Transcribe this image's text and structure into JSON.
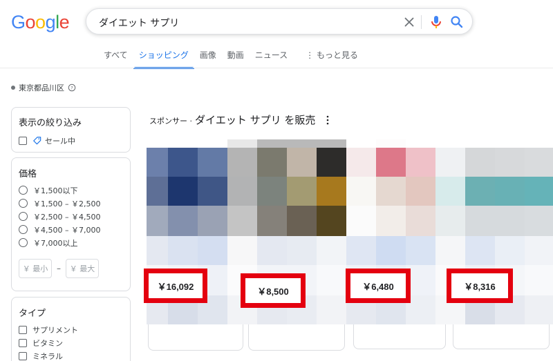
{
  "logo": {
    "letters": [
      "G",
      "o",
      "o",
      "g",
      "l",
      "e"
    ],
    "colors": [
      "#4285f4",
      "#ea4335",
      "#fbbc05",
      "#4285f4",
      "#34a853",
      "#ea4335"
    ]
  },
  "search": {
    "query": "ダイエット サプリ"
  },
  "icons": {
    "clear": "close-icon",
    "mic": "microphone-icon",
    "search": "search-icon",
    "help": "help-circle-icon",
    "kebab": "more-vert-icon",
    "tag": "sale-tag-icon"
  },
  "tabs": [
    {
      "label": "すべて",
      "active": false
    },
    {
      "label": "ショッピング",
      "active": true
    },
    {
      "label": "画像",
      "active": false
    },
    {
      "label": "動画",
      "active": false
    },
    {
      "label": "ニュース",
      "active": false
    },
    {
      "label": "⋮ もっと見る",
      "active": false
    }
  ],
  "location": {
    "label": "東京都品川区"
  },
  "filters": {
    "refine": {
      "title": "表示の絞り込み",
      "sale_label": "セール中"
    },
    "price": {
      "title": "価格",
      "options": [
        "￥1,500以下",
        "￥1,500 – ￥2,500",
        "￥2,500 – ￥4,500",
        "￥4,500 – ￥7,000",
        "￥7,000以上"
      ],
      "min_placeholder": "￥ 最小",
      "dash": "–",
      "max_placeholder": "￥ 最大"
    },
    "type": {
      "title": "タイプ",
      "options": [
        "サプリメント",
        "ビタミン",
        "ミネラル"
      ]
    }
  },
  "sponsored": {
    "prefix": "スポンサー ·",
    "heading": "ダイエット サプリ を販売"
  },
  "products": [
    {
      "price": "￥16,092"
    },
    {
      "price": "￥8,500"
    },
    {
      "price": "￥6,480"
    },
    {
      "price": "￥8,316"
    }
  ],
  "colors": {
    "accent": "#1a73e8",
    "highlight": "#e4000f"
  }
}
